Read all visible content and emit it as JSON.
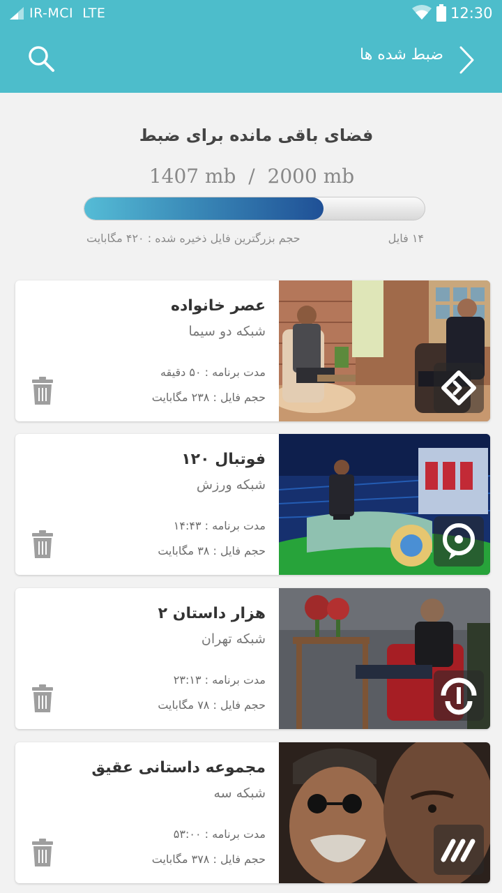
{
  "status_bar": {
    "carrier": "IR-MCI",
    "network": "LTE",
    "time": "12:30",
    "icons": [
      "signal-icon",
      "wifi-icon",
      "battery-icon"
    ]
  },
  "app_bar": {
    "title": "ضبط شده ها",
    "icons": [
      "search-icon",
      "chevron-right-icon"
    ],
    "color": "#4dbdcb"
  },
  "storage": {
    "title": "فضای باقی مانده برای ضبط",
    "used": "1407 mb",
    "separator": "/",
    "total": "2000 mb",
    "fraction": 0.7035,
    "largest_file": "حجم بزرگترین فایل ذخیره شده : ۴۲۰ مگابایت",
    "file_count": "۱۴ فایل"
  },
  "recordings": [
    {
      "title": "عصر خانواده",
      "channel": "شبکه دو سیما",
      "duration": "مدت برنامه : ۵۰ دقیقه",
      "size": "حجم فایل : ۲۳۸ مگابایت",
      "channel_logo": "channel-2-logo-icon"
    },
    {
      "title": "فوتبال ۱۲۰",
      "channel": "شبکه ورزش",
      "duration": "مدت برنامه : ۱۴:۴۳",
      "size": "حجم فایل : ۳۸ مگابایت",
      "channel_logo": "varzesh-logo-icon"
    },
    {
      "title": "هزار داستان ۲",
      "channel": "شبکه تهران",
      "duration": "مدت برنامه : ۲۳:۱۳",
      "size": "حجم فایل : ۷۸ مگابایت",
      "channel_logo": "tehran-logo-icon"
    },
    {
      "title": "مجموعه داستانی عقیق",
      "channel": "شبکه سه",
      "duration": "مدت برنامه : ۵۳:۰۰",
      "size": "حجم فایل : ۳۷۸ مگابایت",
      "channel_logo": "channel-3-logo-icon"
    }
  ]
}
